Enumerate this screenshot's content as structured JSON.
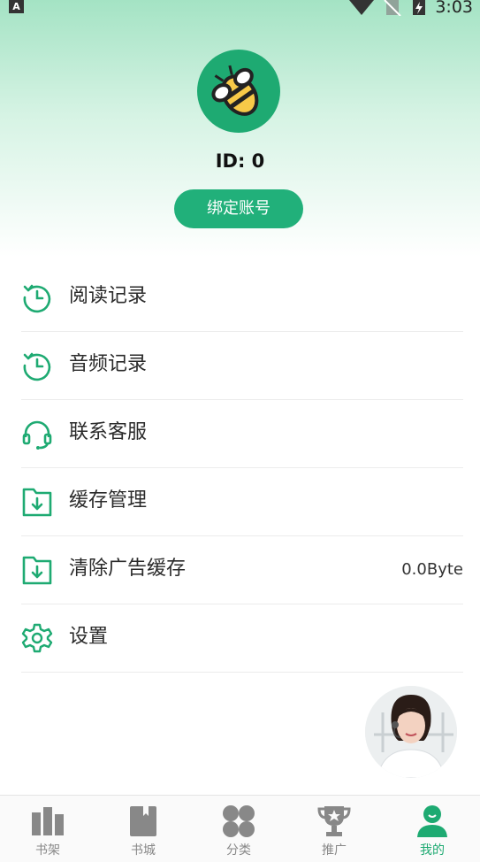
{
  "status_bar": {
    "time": "3:03",
    "app_badge": "A"
  },
  "profile": {
    "id_text": "ID: 0",
    "bind_button": "绑定账号"
  },
  "menu": [
    {
      "label": "阅读记录",
      "icon": "history-icon",
      "value": ""
    },
    {
      "label": "音频记录",
      "icon": "history-icon",
      "value": ""
    },
    {
      "label": "联系客服",
      "icon": "headset-icon",
      "value": ""
    },
    {
      "label": "缓存管理",
      "icon": "download-folder-icon",
      "value": ""
    },
    {
      "label": "清除广告缓存",
      "icon": "download-folder-icon",
      "value": "0.0Byte"
    },
    {
      "label": "设置",
      "icon": "gear-icon",
      "value": ""
    }
  ],
  "tabs": [
    {
      "label": "书架",
      "icon": "bookshelf-icon"
    },
    {
      "label": "书城",
      "icon": "book-icon"
    },
    {
      "label": "分类",
      "icon": "category-icon"
    },
    {
      "label": "推广",
      "icon": "trophy-icon"
    },
    {
      "label": "我的",
      "icon": "user-icon",
      "active": true
    }
  ],
  "colors": {
    "accent": "#1eaa72",
    "accent_button": "#21b07a",
    "hero_top": "#a4e3c4",
    "tab_inactive": "#888888"
  }
}
